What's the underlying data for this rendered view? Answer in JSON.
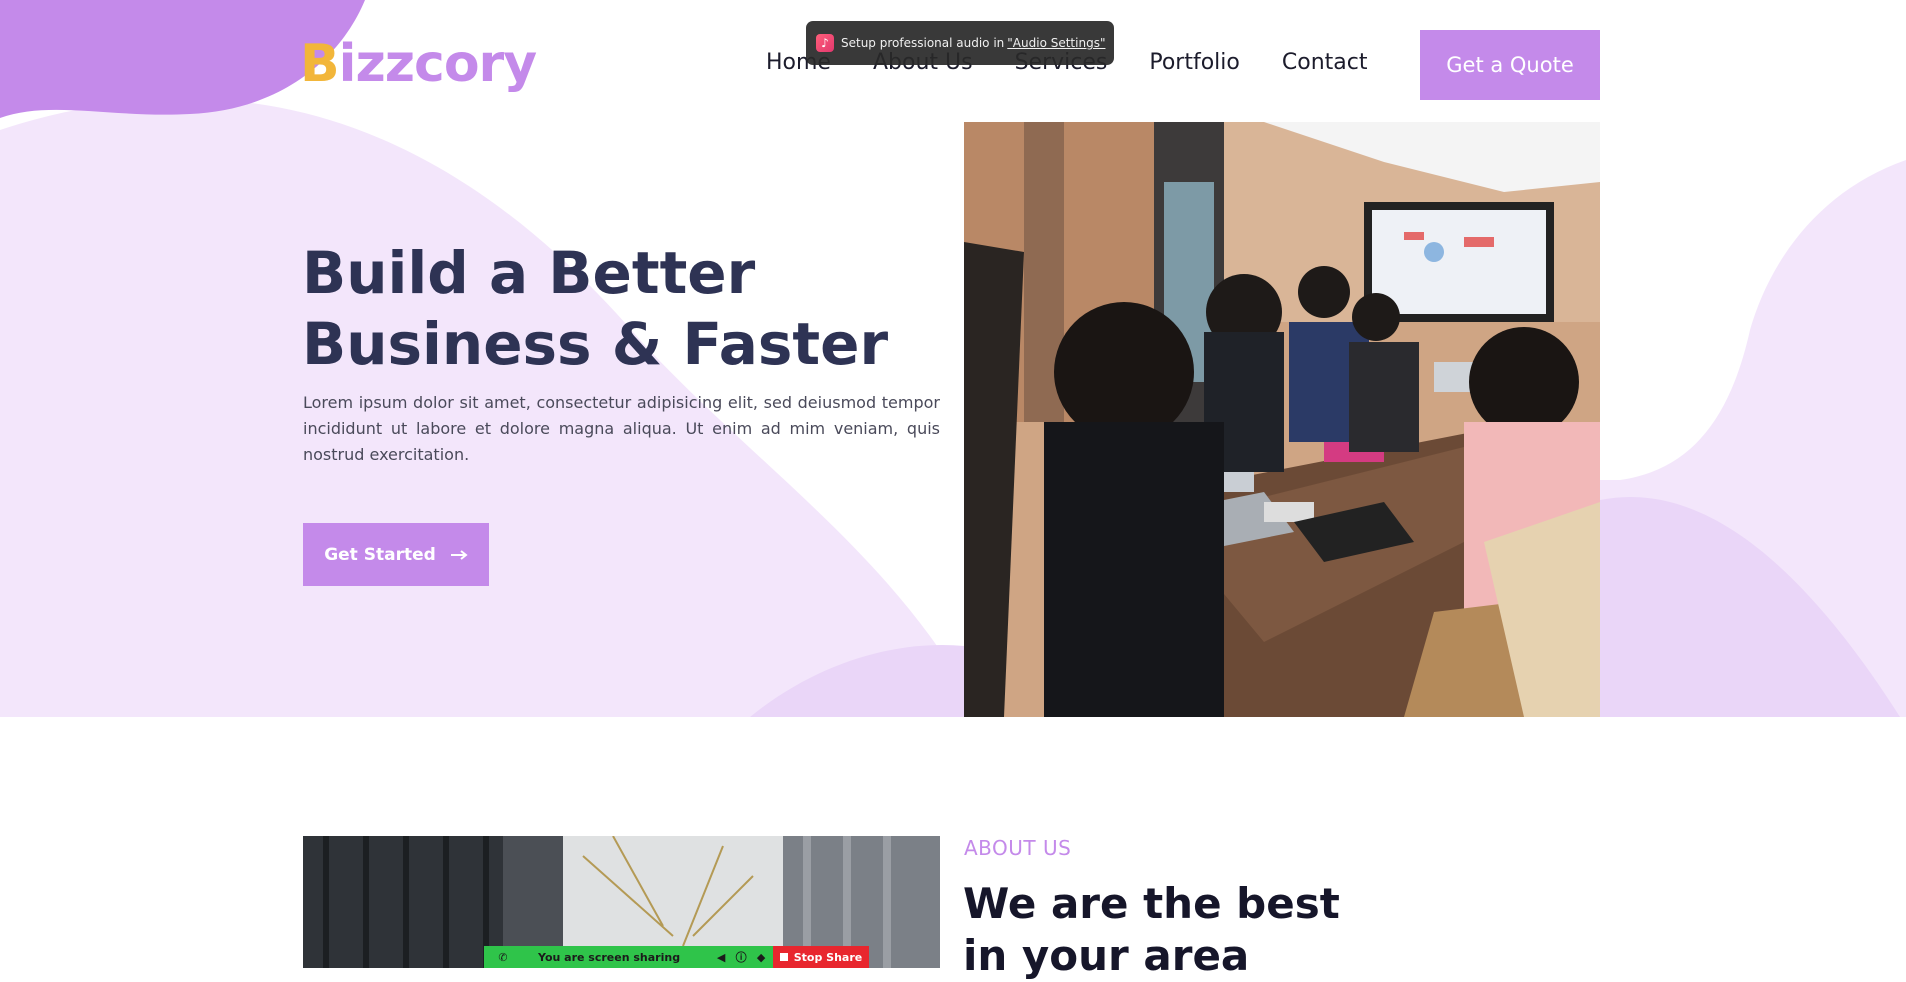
{
  "brand": {
    "logo_first": "B",
    "logo_rest": "izzcory",
    "accent_color": "#c48aea",
    "title_color": "#2e3354"
  },
  "nav": {
    "items": [
      "Home",
      "About Us",
      "Services",
      "Portfolio",
      "Contact"
    ],
    "cta_label": "Get a Quote"
  },
  "notification": {
    "icon": "music-note-icon",
    "text": "Setup professional audio in",
    "link": "\"Audio Settings\""
  },
  "hero": {
    "title_line1": "Build a Better",
    "title_line2": "Business & Faster",
    "description": "Lorem ipsum dolor sit amet, consectetur adipisicing elit, sed deiusmod tempor incididunt ut labore et dolore magna aliqua. Ut enim ad mim veniam, quis nostrud exercitation.",
    "button_label": "Get Started",
    "button_icon": "arrow-right-icon"
  },
  "about": {
    "label": "ABOUT US",
    "title": "We are the best in your area"
  },
  "screen_share": {
    "status_text": "You are screen sharing",
    "stop_label": "Stop Share",
    "status_color": "#2fc44a",
    "stop_color": "#e8262e"
  }
}
